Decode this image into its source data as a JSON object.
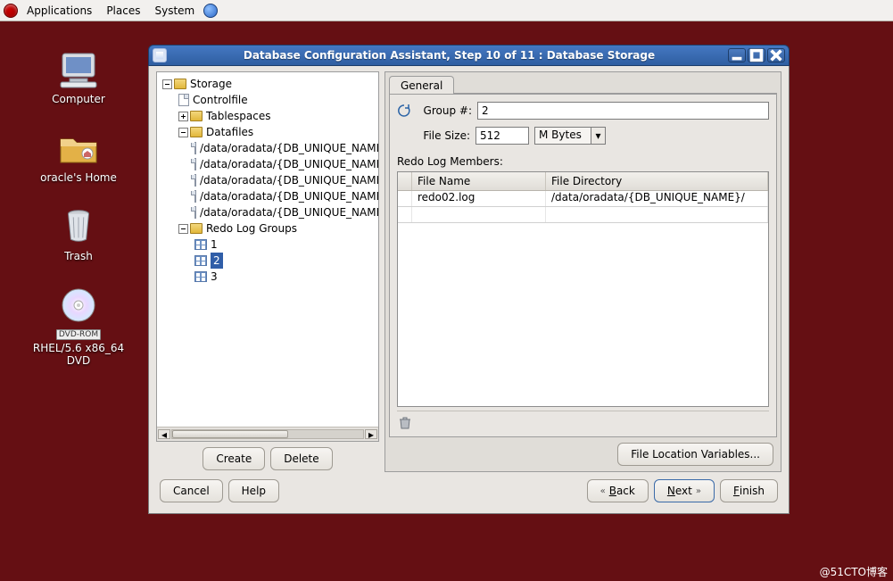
{
  "panel": {
    "applications": "Applications",
    "places": "Places",
    "system": "System"
  },
  "desktop": {
    "computer": "Computer",
    "home": "oracle's Home",
    "trash": "Trash",
    "dvd_badge": "DVD-ROM",
    "dvd": "RHEL/5.6 x86_64 DVD"
  },
  "window": {
    "title": "Database Configuration Assistant, Step 10 of 11 : Database Storage"
  },
  "tree": {
    "root": "Storage",
    "controlfile": "Controlfile",
    "tablespaces": "Tablespaces",
    "datafiles": "Datafiles",
    "dfpath": "/data/oradata/{DB_UNIQUE_NAME}",
    "redogroups": "Redo Log Groups",
    "g1": "1",
    "g2": "2",
    "g3": "3"
  },
  "left_buttons": {
    "create": "Create",
    "delete": "Delete"
  },
  "right": {
    "tab_general": "General",
    "group_no_label": "Group #:",
    "group_no_value": "2",
    "filesize_label": "File Size:",
    "filesize_value": "512",
    "unit": "M Bytes",
    "members_label": "Redo Log Members:",
    "col_filename": "File Name",
    "col_filedir": "File Directory",
    "row1_filename": "redo02.log",
    "row1_filedir": "/data/oradata/{DB_UNIQUE_NAME}/"
  },
  "right_buttons": {
    "file_location": "File Location Variables..."
  },
  "wizard": {
    "cancel": "Cancel",
    "help": "Help",
    "back": "Back",
    "next": "Next",
    "finish": "Finish"
  },
  "watermark": "@51CTO博客"
}
